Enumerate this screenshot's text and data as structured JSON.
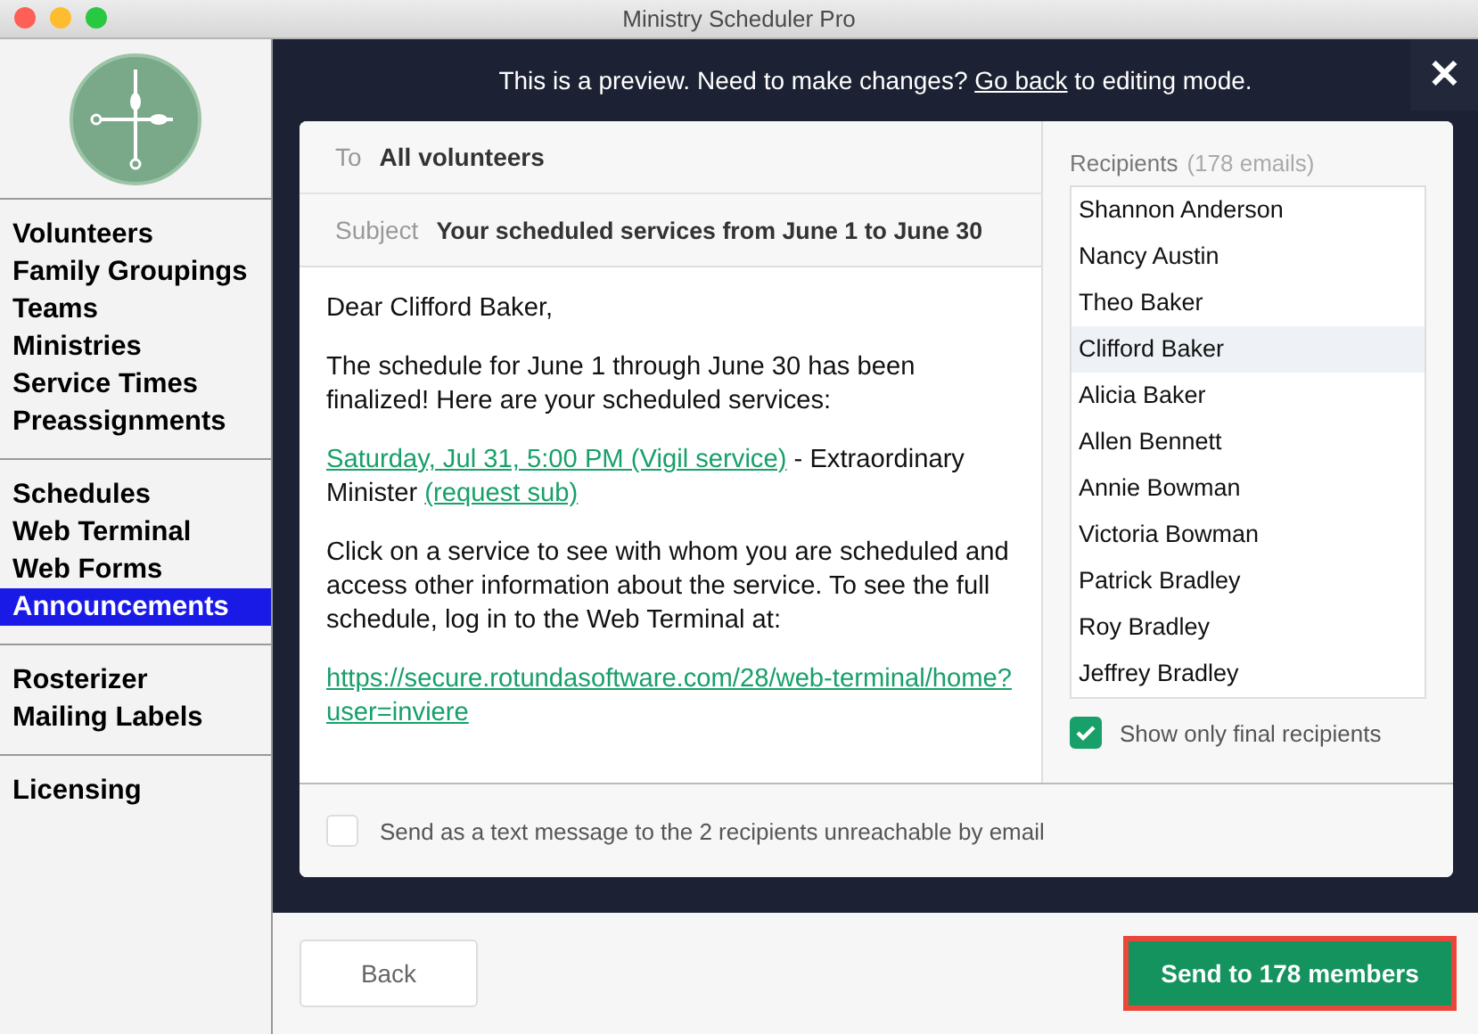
{
  "window": {
    "title": "Ministry Scheduler Pro"
  },
  "sidebar": {
    "groups": [
      {
        "items": [
          {
            "label": "Volunteers",
            "selected": false
          },
          {
            "label": "Family Groupings",
            "selected": false
          },
          {
            "label": "Teams",
            "selected": false
          },
          {
            "label": "Ministries",
            "selected": false
          },
          {
            "label": "Service Times",
            "selected": false
          },
          {
            "label": "Preassignments",
            "selected": false
          }
        ]
      },
      {
        "items": [
          {
            "label": "Schedules",
            "selected": false
          },
          {
            "label": "Web Terminal",
            "selected": false
          },
          {
            "label": "Web Forms",
            "selected": false
          },
          {
            "label": "Announcements",
            "selected": true
          }
        ]
      },
      {
        "items": [
          {
            "label": "Rosterizer",
            "selected": false
          },
          {
            "label": "Mailing Labels",
            "selected": false
          }
        ]
      },
      {
        "items": [
          {
            "label": "Licensing",
            "selected": false
          }
        ]
      }
    ]
  },
  "banner": {
    "before": "This is a preview. Need to make changes?",
    "link": "Go back",
    "after": "to editing mode.",
    "close": "✕"
  },
  "email": {
    "to_label": "To",
    "to": "All volunteers",
    "subject_label": "Subject",
    "subject": "Your scheduled services from June 1 to June 30",
    "body": [
      [
        {
          "kind": "text",
          "text": "Dear Clifford Baker,"
        }
      ],
      [
        {
          "kind": "text",
          "text": "The schedule for June 1 through June 30 has been finalized! Here are your scheduled services:"
        }
      ],
      [
        {
          "kind": "link",
          "text": "Saturday, Jul 31, 5:00 PM (Vigil service)"
        },
        {
          "kind": "text",
          "text": " - Extraordinary Minister "
        },
        {
          "kind": "link",
          "text": "(request sub)"
        }
      ],
      [
        {
          "kind": "text",
          "text": "Click on a service to see with whom you are scheduled and access other information about the service. To see the full schedule, log in to the Web Terminal at:"
        }
      ],
      [
        {
          "kind": "link",
          "text": "https://secure.rotundasoftware.com/28/web-terminal/home?user=inviere"
        }
      ]
    ]
  },
  "recipients": {
    "label": "Recipients",
    "count": "(178 emails)",
    "items": [
      {
        "name": "Shannon Anderson",
        "selected": false
      },
      {
        "name": "Nancy Austin",
        "selected": false
      },
      {
        "name": "Theo Baker",
        "selected": false
      },
      {
        "name": "Clifford Baker",
        "selected": true
      },
      {
        "name": "Alicia Baker",
        "selected": false
      },
      {
        "name": "Allen Bennett",
        "selected": false
      },
      {
        "name": "Annie Bowman",
        "selected": false
      },
      {
        "name": "Victoria Bowman",
        "selected": false
      },
      {
        "name": "Patrick Bradley",
        "selected": false
      },
      {
        "name": "Roy Bradley",
        "selected": false
      },
      {
        "name": "Jeffrey Bradley",
        "selected": false
      }
    ],
    "final_only": {
      "label": "Show only final recipients",
      "checked": true
    }
  },
  "text_message": {
    "label": "Send as a text message to the 2 recipients unreachable by email",
    "checked": false
  },
  "buttons": {
    "back": "Back",
    "send": "Send to 178 members"
  }
}
